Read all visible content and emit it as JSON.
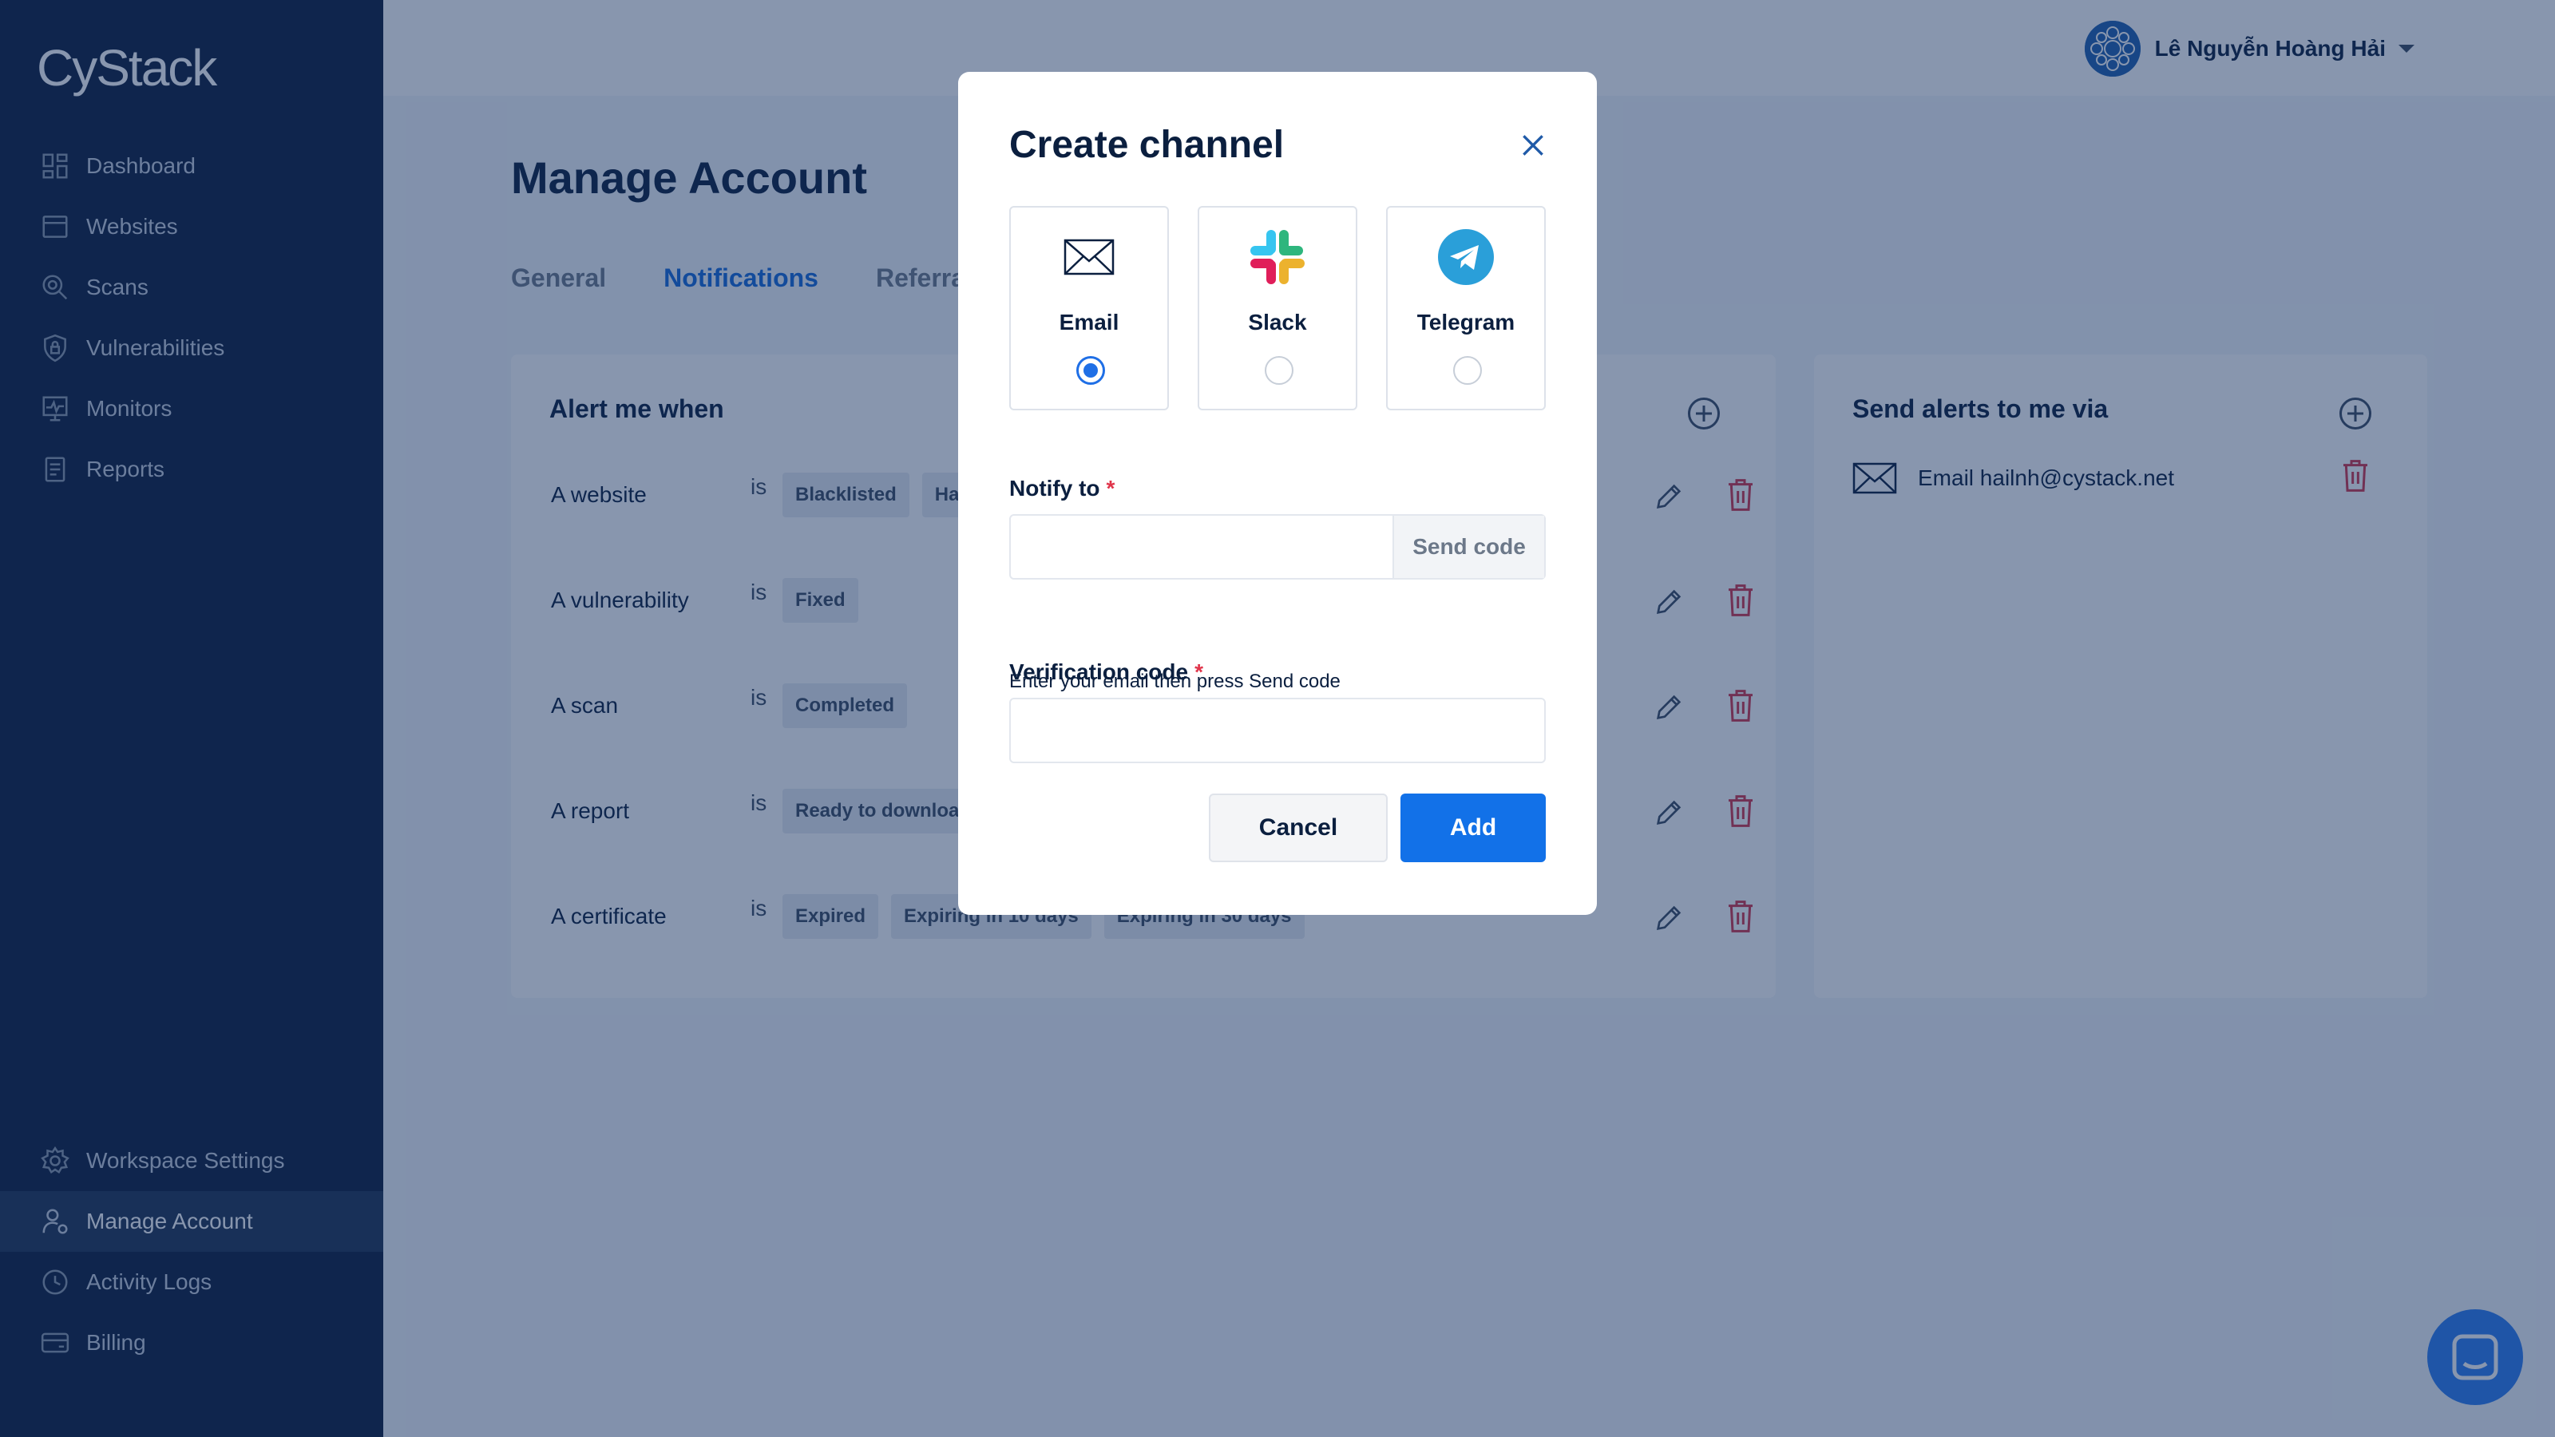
{
  "brand": {
    "name": "CyStack"
  },
  "sidebar": {
    "top_items": [
      {
        "label": "Dashboard",
        "icon": "dashboard-icon"
      },
      {
        "label": "Websites",
        "icon": "browser-icon"
      },
      {
        "label": "Scans",
        "icon": "scan-icon"
      },
      {
        "label": "Vulnerabilities",
        "icon": "shield-icon"
      },
      {
        "label": "Monitors",
        "icon": "monitor-icon"
      },
      {
        "label": "Reports",
        "icon": "report-icon"
      }
    ],
    "bottom_items": [
      {
        "label": "Workspace Settings",
        "icon": "gear-icon"
      },
      {
        "label": "Manage Account",
        "icon": "user-gear-icon",
        "active": true
      },
      {
        "label": "Activity Logs",
        "icon": "clock-icon"
      },
      {
        "label": "Billing",
        "icon": "card-icon"
      }
    ]
  },
  "header": {
    "user_name": "Lê Nguyễn Hoàng Hải"
  },
  "page": {
    "title": "Manage Account",
    "tabs": [
      {
        "label": "General"
      },
      {
        "label": "Notifications",
        "active": true
      },
      {
        "label": "Referra"
      }
    ]
  },
  "alert_card": {
    "title": "Alert me when",
    "rules": [
      {
        "label": "A website",
        "is": "is",
        "tags": [
          "Blacklisted",
          "Ha"
        ]
      },
      {
        "label": "A vulnerability",
        "is": "is",
        "tags": [
          "Fixed"
        ]
      },
      {
        "label": "A scan",
        "is": "is",
        "tags": [
          "Completed"
        ]
      },
      {
        "label": "A report",
        "is": "is",
        "tags": [
          "Ready to downloa"
        ]
      },
      {
        "label": "A certificate",
        "is": "is",
        "tags": [
          "Expired",
          "Expiring in 10 days",
          "Expiring in 30 days"
        ]
      }
    ]
  },
  "send_card": {
    "title": "Send alerts to me via",
    "channels": [
      {
        "text": "Email hailnh@cystack.net",
        "icon": "mail-icon"
      }
    ]
  },
  "modal": {
    "title": "Create channel",
    "options": [
      {
        "label": "Email",
        "icon": "mail-icon",
        "selected": true
      },
      {
        "label": "Slack",
        "icon": "slack-icon",
        "selected": false
      },
      {
        "label": "Telegram",
        "icon": "telegram-icon",
        "selected": false
      }
    ],
    "notify_label": "Notify to",
    "required_mark": "*",
    "notify_value": "",
    "send_code_label": "Send code",
    "helper_text": "Enter your email then press Send code",
    "verification_label": "Verification code",
    "verification_value": "",
    "cancel_label": "Cancel",
    "add_label": "Add"
  },
  "colors": {
    "sidebar_bg": "#0c1c3c",
    "accent": "#1271e8",
    "danger": "#e0344a",
    "overlay": "rgba(17,45,94,0.5)"
  }
}
